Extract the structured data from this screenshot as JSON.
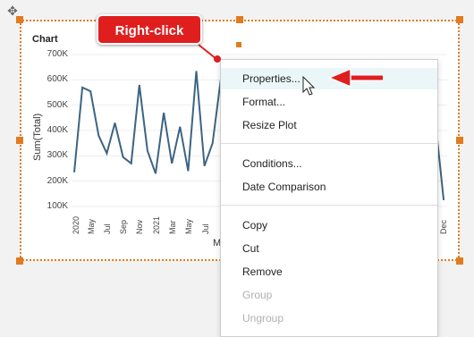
{
  "chart": {
    "title": "Chart",
    "ylabel": "Sum(Total)",
    "xlabel_partial": "M",
    "y_ticks": [
      "700K",
      "600K",
      "500K",
      "400K",
      "300K",
      "200K",
      "100K"
    ],
    "x_ticks": [
      "2020",
      "May",
      "Jul",
      "Sep",
      "Nov",
      "2021",
      "Mar",
      "May",
      "Jul",
      "Dec"
    ],
    "line_color": "#3d6482"
  },
  "chart_data": {
    "type": "line",
    "title": "Chart",
    "xlabel": "M",
    "ylabel": "Sum(Total)",
    "ylim": [
      100000,
      700000
    ],
    "series": [
      {
        "values": [
          235000,
          570000,
          555000,
          380000,
          310000,
          430000,
          295000,
          270000,
          580000,
          320000,
          230000,
          470000,
          270000,
          415000,
          240000,
          635000,
          260000,
          350000,
          600000
        ]
      },
      {
        "values": [
          430000,
          125000
        ]
      }
    ]
  },
  "context_menu": {
    "items": [
      {
        "label": "Properties...",
        "disabled": false
      },
      {
        "label": "Format...",
        "disabled": false
      },
      {
        "label": "Resize Plot",
        "disabled": false
      },
      {
        "label": "Conditions...",
        "disabled": false
      },
      {
        "label": "Date Comparison",
        "disabled": false
      },
      {
        "label": "Copy",
        "disabled": false
      },
      {
        "label": "Cut",
        "disabled": false
      },
      {
        "label": "Remove",
        "disabled": false
      },
      {
        "label": "Group",
        "disabled": true
      },
      {
        "label": "Ungroup",
        "disabled": true
      }
    ]
  },
  "callout": {
    "label": "Right-click",
    "color": "#e01e1e"
  },
  "icons": {
    "move": "move-icon",
    "cursor": "mouse-cursor-icon",
    "arrow": "red-arrow-icon"
  }
}
